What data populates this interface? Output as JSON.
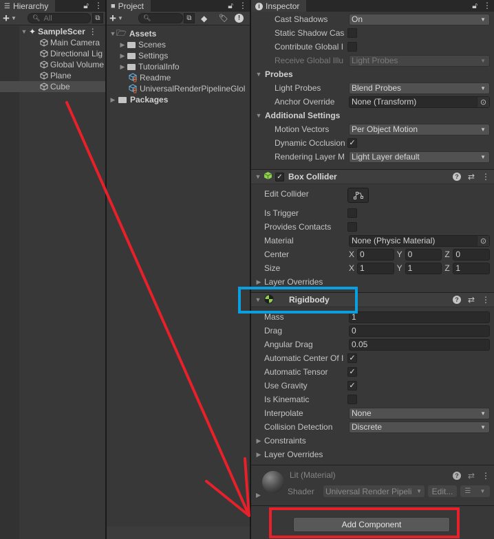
{
  "hierarchy": {
    "tab_label": "Hierarchy",
    "search_placeholder": "All",
    "scene": "SampleScer",
    "items": [
      {
        "label": "Main Camera",
        "selected": false
      },
      {
        "label": "Directional Lig",
        "selected": false
      },
      {
        "label": "Global Volume",
        "selected": false
      },
      {
        "label": "Plane",
        "selected": false
      },
      {
        "label": "Cube",
        "selected": true
      }
    ]
  },
  "project": {
    "tab_label": "Project",
    "search_placeholder": "",
    "assets_label": "Assets",
    "asset_folders": [
      "Scenes",
      "Settings",
      "TutorialInfo"
    ],
    "asset_files": [
      "Readme",
      "UniversalRenderPipelineGlol"
    ],
    "packages_label": "Packages"
  },
  "inspector": {
    "tab_label": "Inspector",
    "mesh_renderer": {
      "cast_shadows_label": "Cast Shadows",
      "cast_shadows_value": "On",
      "static_shadow_label": "Static Shadow Cas",
      "static_shadow_checked": false,
      "contribute_gi_label": "Contribute Global I",
      "contribute_gi_checked": false,
      "receive_gi_label": "Receive Global Illu",
      "receive_gi_value": "Light Probes",
      "probes_section": "Probes",
      "light_probes_label": "Light Probes",
      "light_probes_value": "Blend Probes",
      "anchor_override_label": "Anchor Override",
      "anchor_override_value": "None (Transform)",
      "additional_section": "Additional Settings",
      "motion_vectors_label": "Motion Vectors",
      "motion_vectors_value": "Per Object Motion",
      "dynamic_occlusion_label": "Dynamic Occlusion",
      "dynamic_occlusion_checked": true,
      "rendering_layer_label": "Rendering Layer M",
      "rendering_layer_value": "Light Layer default"
    },
    "box_collider": {
      "title": "Box Collider",
      "enabled": true,
      "edit_collider_label": "Edit Collider",
      "is_trigger_label": "Is Trigger",
      "is_trigger_checked": false,
      "provides_contacts_label": "Provides Contacts",
      "provides_contacts_checked": false,
      "material_label": "Material",
      "material_value": "None (Physic Material)",
      "center_label": "Center",
      "center": {
        "x": "0",
        "y": "0",
        "z": "0"
      },
      "size_label": "Size",
      "size": {
        "x": "1",
        "y": "1",
        "z": "1"
      },
      "layer_overrides_label": "Layer Overrides"
    },
    "rigidbody": {
      "title": "Rigidbody",
      "mass_label": "Mass",
      "mass_value": "1",
      "drag_label": "Drag",
      "drag_value": "0",
      "angular_drag_label": "Angular Drag",
      "angular_drag_value": "0.05",
      "auto_center_label": "Automatic Center Of I",
      "auto_center_checked": true,
      "auto_tensor_label": "Automatic Tensor",
      "auto_tensor_checked": true,
      "use_gravity_label": "Use Gravity",
      "use_gravity_checked": true,
      "is_kinematic_label": "Is Kinematic",
      "is_kinematic_checked": false,
      "interpolate_label": "Interpolate",
      "interpolate_value": "None",
      "collision_label": "Collision Detection",
      "collision_value": "Discrete",
      "constraints_label": "Constraints",
      "layer_overrides_label": "Layer Overrides"
    },
    "material": {
      "title": "Lit (Material)",
      "shader_label": "Shader",
      "shader_value": "Universal Render Pipeli",
      "edit_label": "Edit..."
    },
    "add_component_label": "Add Component"
  },
  "annotations": {
    "arrow_color": "#e8202a",
    "highlight_box_color": "#0aa0e0",
    "add_component_box_color": "#e8202a"
  }
}
